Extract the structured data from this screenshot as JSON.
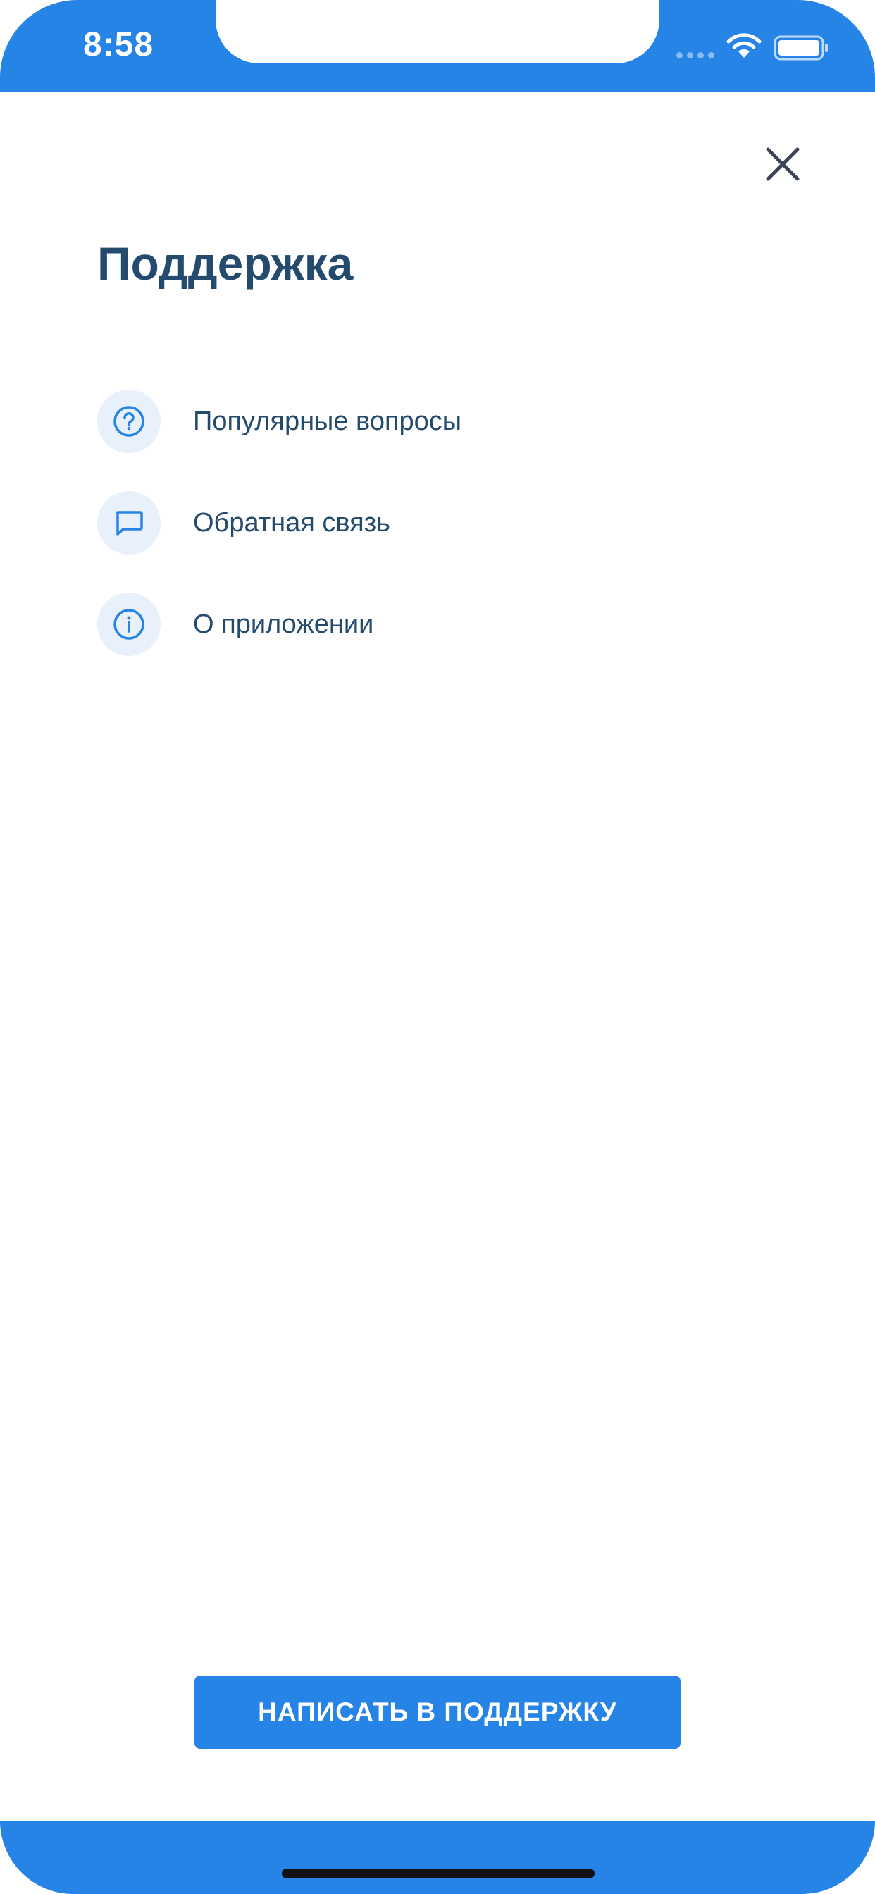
{
  "status_bar": {
    "time": "8:58",
    "wifi_icon": "wifi-icon",
    "battery_icon": "battery-icon"
  },
  "header": {
    "close_icon": "close-icon"
  },
  "page": {
    "title": "Поддержка"
  },
  "menu": {
    "items": [
      {
        "icon": "question-circle-icon",
        "label": "Популярные вопросы"
      },
      {
        "icon": "chat-bubble-icon",
        "label": "Обратная связь"
      },
      {
        "icon": "info-circle-icon",
        "label": "О приложении"
      }
    ]
  },
  "actions": {
    "write_support_label": "НАПИСАТЬ В ПОДДЕРЖКУ"
  },
  "colors": {
    "accent": "#2684e6",
    "title": "#244a6e",
    "icon_bg": "#e8f0fb",
    "close": "#3a4556"
  }
}
